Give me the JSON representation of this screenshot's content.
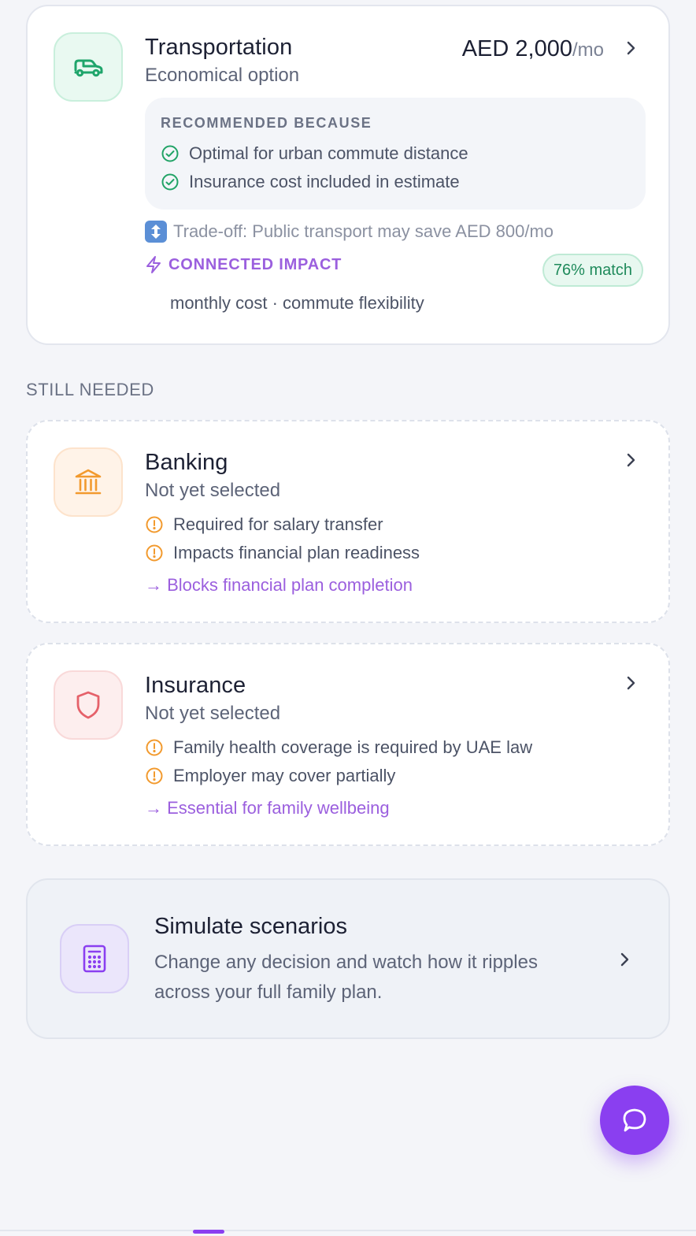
{
  "transport": {
    "title": "Transportation",
    "subtitle": "Economical option",
    "price": "AED 2,000",
    "price_unit": "/mo",
    "icon": "car-icon",
    "recommended_heading": "RECOMMENDED BECAUSE",
    "reasons": [
      "Optimal for urban commute distance",
      "Insurance cost included in estimate"
    ],
    "tradeoff": "Trade-off: Public transport may save AED 800/mo",
    "impact_label": "CONNECTED IMPACT",
    "match": "76% match",
    "impact_detail": "monthly cost · commute flexibility"
  },
  "still_needed_label": "STILL NEEDED",
  "banking": {
    "title": "Banking",
    "subtitle": "Not yet selected",
    "icon": "bank-icon",
    "notes": [
      "Required for salary transfer",
      "Impacts financial plan readiness"
    ],
    "blocker": "→ Blocks financial plan completion"
  },
  "insurance": {
    "title": "Insurance",
    "subtitle": "Not yet selected",
    "icon": "shield-icon",
    "notes": [
      "Family health coverage is required by UAE law",
      "Employer may cover partially"
    ],
    "blocker": "→ Essential for family wellbeing"
  },
  "simulate": {
    "title": "Simulate scenarios",
    "description": "Change any decision and watch how it ripples across your full family plan.",
    "icon": "calculator-icon"
  },
  "fab": {
    "icon": "chat-bubble-icon"
  },
  "colors": {
    "accent": "#8a3ff0",
    "success": "#21a366",
    "warning": "#f29a2e",
    "danger": "#e5616a"
  }
}
